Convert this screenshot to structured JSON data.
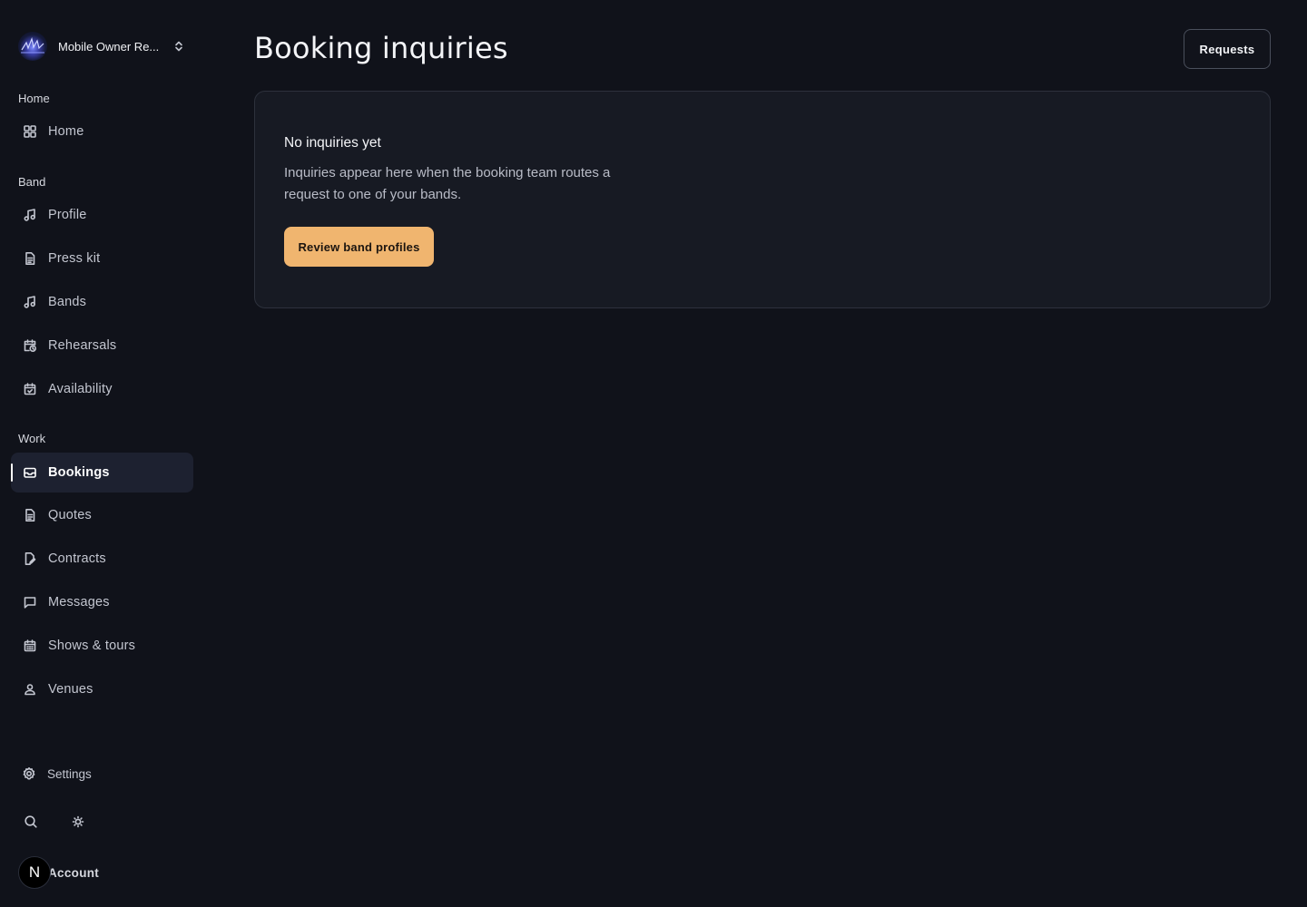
{
  "workspace": {
    "name": "Mobile Owner Re..."
  },
  "sidebar": {
    "sections": [
      {
        "label": "Home",
        "items": [
          {
            "label": "Home",
            "icon": "layout-grid-icon"
          }
        ]
      },
      {
        "label": "Band",
        "items": [
          {
            "label": "Profile",
            "icon": "music-note-icon"
          },
          {
            "label": "Press kit",
            "icon": "document-icon"
          },
          {
            "label": "Bands",
            "icon": "music-note-icon"
          },
          {
            "label": "Rehearsals",
            "icon": "calendar-clock-icon"
          },
          {
            "label": "Availability",
            "icon": "calendar-check-icon"
          }
        ]
      },
      {
        "label": "Work",
        "items": [
          {
            "label": "Bookings",
            "icon": "inbox-icon",
            "active": true
          },
          {
            "label": "Quotes",
            "icon": "document-icon"
          },
          {
            "label": "Contracts",
            "icon": "document-edit-icon"
          },
          {
            "label": "Messages",
            "icon": "message-square-icon"
          },
          {
            "label": "Shows & tours",
            "icon": "calendar-grid-icon"
          },
          {
            "label": "Venues",
            "icon": "map-pin-user-icon"
          }
        ]
      }
    ],
    "settings_label": "Settings",
    "account_label": "Account",
    "account_initial": "N"
  },
  "main": {
    "title": "Booking inquiries",
    "requests_label": "Requests",
    "empty_state": {
      "title": "No inquiries yet",
      "description": "Inquiries appear here when the booking team routes a request to one of your bands.",
      "button_label": "Review band profiles"
    }
  },
  "colors": {
    "background": "#10121a",
    "card": "#171a23",
    "accent": "#f0b56f",
    "active_nav": "#1d2130"
  }
}
